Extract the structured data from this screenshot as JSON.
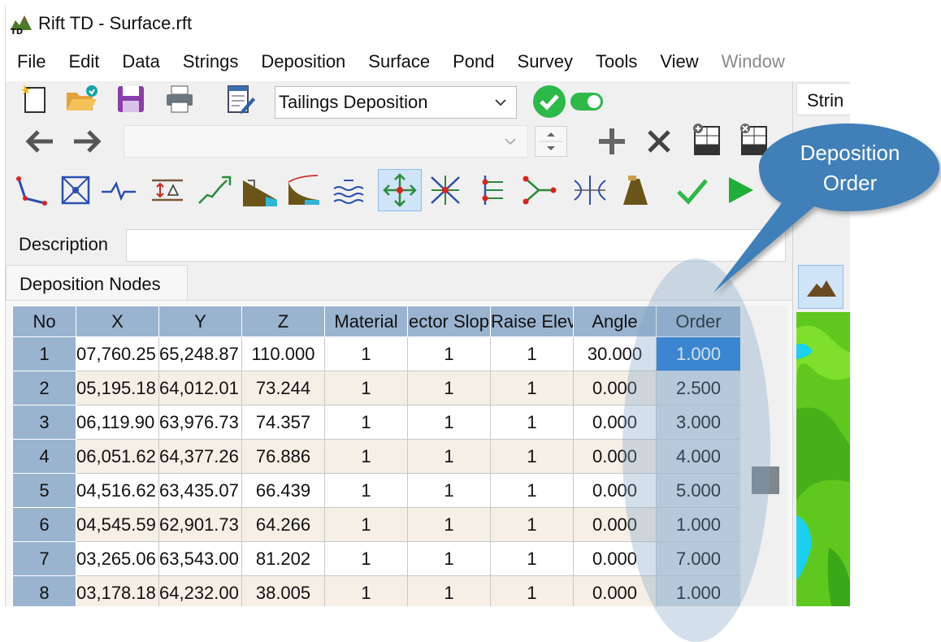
{
  "window": {
    "title": "Rift TD - Surface.rft"
  },
  "menu": [
    "File",
    "Edit",
    "Data",
    "Strings",
    "Deposition",
    "Surface",
    "Pond",
    "Survey",
    "Tools",
    "View",
    "Window"
  ],
  "toolbar": {
    "mode_select": "Tailings Deposition",
    "string_select": ""
  },
  "description": {
    "label": "Description",
    "value": ""
  },
  "tabs": {
    "active": "Deposition Nodes",
    "right_pane": "Strin"
  },
  "table": {
    "columns": [
      "No",
      "X",
      "Y",
      "Z",
      "Material",
      "ector Slop",
      "Raise Elev",
      "Angle",
      "Order"
    ],
    "rows": [
      [
        "1",
        "07,760.25",
        "65,248.87",
        "110.000",
        "1",
        "1",
        "1",
        "30.000",
        "1.000"
      ],
      [
        "2",
        "05,195.18",
        "64,012.01",
        "73.244",
        "1",
        "1",
        "1",
        "0.000",
        "2.500"
      ],
      [
        "3",
        "06,119.90",
        "63,976.73",
        "74.357",
        "1",
        "1",
        "1",
        "0.000",
        "3.000"
      ],
      [
        "4",
        "06,051.62",
        "64,377.26",
        "76.886",
        "1",
        "1",
        "1",
        "0.000",
        "4.000"
      ],
      [
        "5",
        "04,516.62",
        "63,435.07",
        "66.439",
        "1",
        "1",
        "1",
        "0.000",
        "5.000"
      ],
      [
        "6",
        "04,545.59",
        "62,901.73",
        "64.266",
        "1",
        "1",
        "1",
        "0.000",
        "1.000"
      ],
      [
        "7",
        "03,265.06",
        "63,543.00",
        "81.202",
        "1",
        "1",
        "1",
        "0.000",
        "7.000"
      ],
      [
        "8",
        "03,178.18",
        "64,232.00",
        "38.005",
        "1",
        "1",
        "1",
        "0.000",
        "1.000"
      ]
    ]
  },
  "callout": {
    "line1": "Deposition",
    "line2": "Order"
  },
  "colors": {
    "header": "#9ab4d0",
    "selected": "#1f7ad9",
    "callout": "#3f7fb8",
    "accent_green": "#2db84a"
  }
}
